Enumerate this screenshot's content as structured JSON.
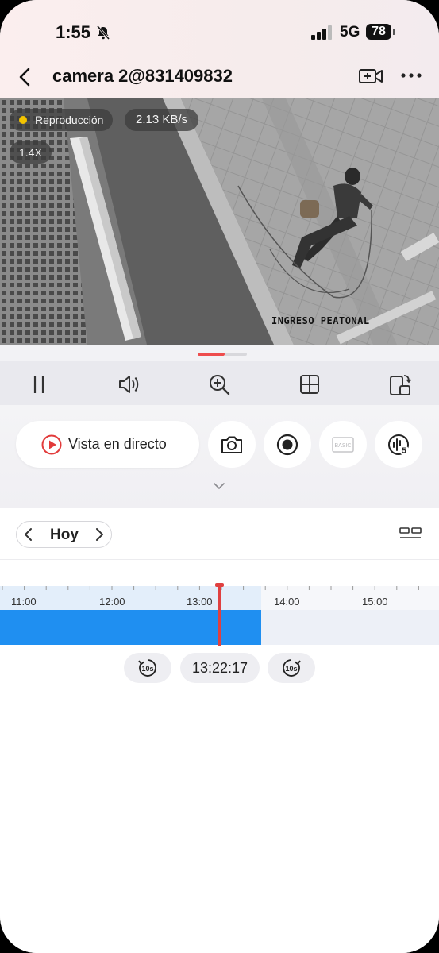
{
  "status_bar": {
    "time": "1:55",
    "network": "5G",
    "battery": "78",
    "icons": [
      "bell-slash-icon",
      "signal-icon",
      "battery-icon"
    ]
  },
  "header": {
    "title": "camera 2@831409832",
    "icons": [
      "back-arrow-icon",
      "add-video-icon",
      "more-dots-icon"
    ]
  },
  "video": {
    "status_label": "Reproducción",
    "bitrate": "2.13 KB/s",
    "zoom": "1.4X",
    "osd_text": "INGRESO PEATONAL",
    "status_dot_color": "#f4c400"
  },
  "toolbar": {
    "icons": [
      "pause-icon",
      "volume-icon",
      "zoom-in-icon",
      "grid-icon",
      "rotate-screen-icon"
    ]
  },
  "actions": {
    "live_label": "Vista en directo",
    "basic_label": "BASIC",
    "speed_badge": "5",
    "icons": [
      "play-circle-icon",
      "camera-snapshot-icon",
      "record-icon",
      "quality-basic-icon",
      "voice-intercom-icon",
      "chevron-down-icon"
    ]
  },
  "timeline": {
    "day_label": "Hoy",
    "tick_labels": [
      "11:00",
      "12:00",
      "13:00",
      "14:00",
      "15:00"
    ],
    "current_time": "13:22:17",
    "rewind_label": "10s",
    "forward_label": "10s",
    "accent_color": "#1f8ff1",
    "cursor_color": "#e04040"
  }
}
